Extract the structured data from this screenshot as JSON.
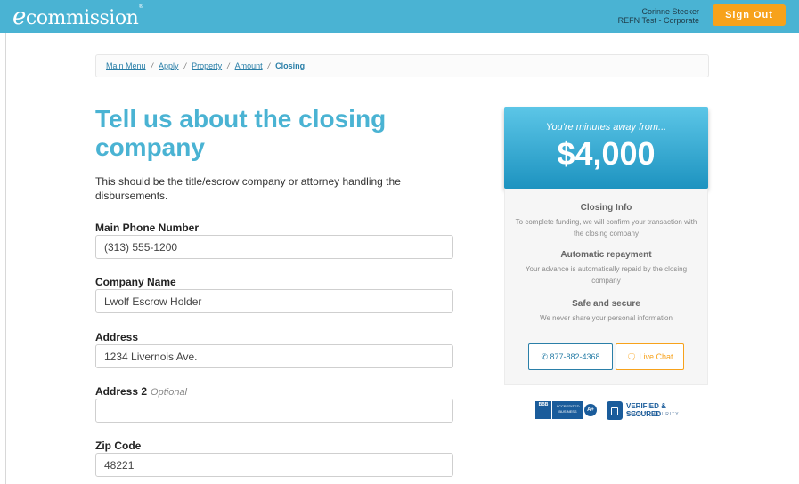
{
  "header": {
    "logo_e": "e",
    "logo_text": "commission",
    "logo_mark": "®",
    "user_name": "Corinne Stecker",
    "user_org": "REFN Test - Corporate",
    "sign_out_label": "Sign Out"
  },
  "breadcrumb": {
    "items": [
      "Main Menu",
      "Apply",
      "Property",
      "Amount"
    ],
    "separator": "/",
    "current": "Closing"
  },
  "main": {
    "title": "Tell us about the closing company",
    "description": "This should be the title/escrow company or attorney handling the disbursements.",
    "fields": {
      "phone": {
        "label": "Main Phone Number",
        "value": "(313) 555-1200"
      },
      "company": {
        "label": "Company Name",
        "value": "Lwolf Escrow Holder"
      },
      "address": {
        "label": "Address",
        "value": "1234 Livernois Ave."
      },
      "address2": {
        "label": "Address 2",
        "optional": "Optional",
        "value": ""
      },
      "zip": {
        "label": "Zip Code",
        "value": "48221"
      }
    }
  },
  "sidebar": {
    "promo_subtitle": "You're minutes away from...",
    "promo_amount": "$4,000",
    "closing_info": {
      "title": "Closing Info",
      "text": "To complete funding, we will confirm your transaction with the closing company"
    },
    "repayment": {
      "title": "Automatic repayment",
      "text": "Your advance is automatically repaid by the closing company"
    },
    "secure": {
      "title": "Safe and secure",
      "text": "We never share your personal information"
    },
    "phone_button": "877-882-4368",
    "chat_button": "Live Chat"
  },
  "badges": {
    "bbb_short": "BBB",
    "bbb_text": "ACCREDITED BUSINESS",
    "bbb_rating": "A+",
    "verify_title": "VERIFIED & SECURED",
    "verify_sub": "VERIFY SECURITY"
  },
  "colors": {
    "brand": "#4ab3d3",
    "accent": "#f7a21b",
    "link": "#2a7fa8"
  }
}
